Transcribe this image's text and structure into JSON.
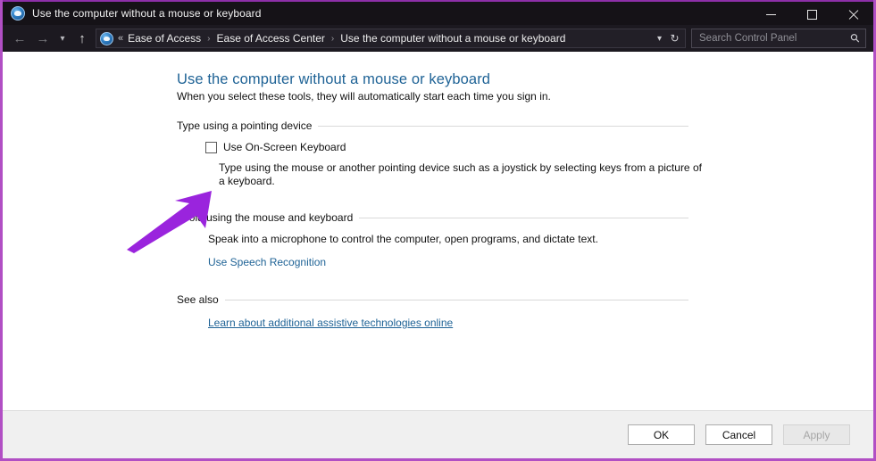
{
  "colors": {
    "accent_purple": "#9a24dd",
    "link_blue": "#1f6396",
    "title_blue": "#1f6396",
    "window_border": "#b14fc4",
    "titlebar_bg": "#151217",
    "footer_bg": "#f0f0f0"
  },
  "titlebar": {
    "icon": "ease-of-access-icon",
    "title": "Use the computer without a mouse or keyboard",
    "minimize_label": "Minimize",
    "maximize_label": "Maximize",
    "close_label": "Close"
  },
  "navbar": {
    "back_icon": "back-arrow-icon",
    "forward_icon": "forward-arrow-icon",
    "recent_icon": "chevron-down-icon",
    "up_icon": "up-arrow-icon",
    "breadcrumb_icon": "ease-of-access-icon",
    "breadcrumb_overflow": "«",
    "breadcrumbs": [
      "Ease of Access",
      "Ease of Access Center",
      "Use the computer without a mouse or keyboard"
    ],
    "separator": "›",
    "dropdown_icon": "chevron-down-icon",
    "refresh_icon": "refresh-icon",
    "search_placeholder": "Search Control Panel",
    "search_value": "",
    "search_icon": "search-icon"
  },
  "main": {
    "title": "Use the computer without a mouse or keyboard",
    "subtitle": "When you select these tools, they will automatically start each time you sign in.",
    "sections": [
      {
        "heading": "Type using a pointing device",
        "checkbox_label": "Use On-Screen Keyboard",
        "checkbox_checked": false,
        "description": "Type using the mouse or another pointing device such as a joystick by selecting keys from a picture of a keyboard."
      },
      {
        "heading": "Avoid using the mouse and keyboard",
        "description": "Speak into a microphone to control the computer, open programs, and dictate text.",
        "link": "Use Speech Recognition"
      },
      {
        "heading": "See also",
        "link": "Learn about additional assistive technologies online"
      }
    ]
  },
  "annotation": {
    "arrow_name": "purple-arrow-annotation",
    "arrow_color": "#9a24dd",
    "points_to": "Use On-Screen Keyboard checkbox"
  },
  "footer": {
    "ok_label": "OK",
    "cancel_label": "Cancel",
    "apply_label": "Apply",
    "apply_disabled": true
  }
}
